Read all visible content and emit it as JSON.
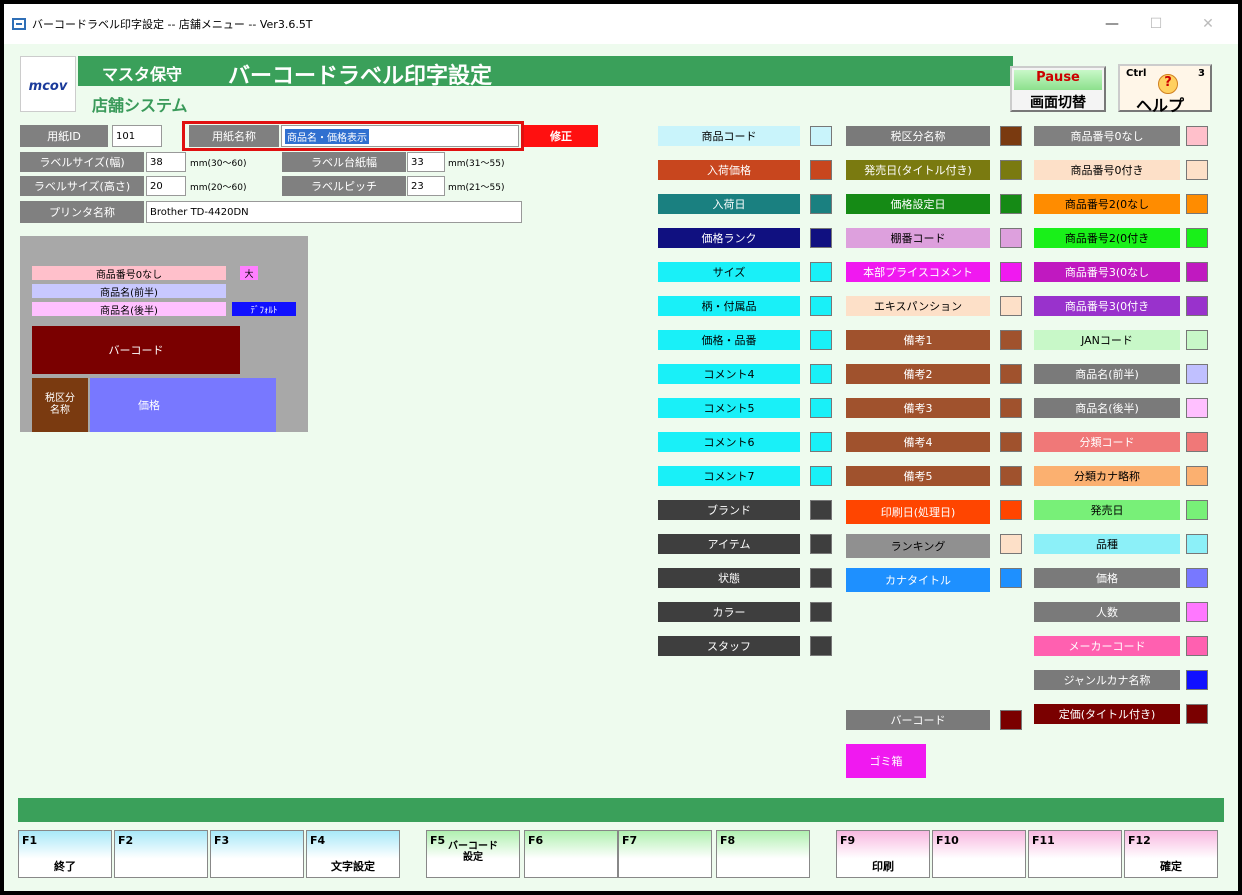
{
  "window": {
    "title": "バーコードラベル印字設定 -- 店舗メニュー -- Ver3.6.5T",
    "minimize": "—",
    "maximize": "☐",
    "close": "✕"
  },
  "header": {
    "logo": "mcov",
    "section": "マスタ保守",
    "title": "バーコードラベル印字設定",
    "system": "店舗システム",
    "pause_label": "Pause",
    "pause_sub": "画面切替",
    "help_ctrl": "Ctrl",
    "help_num": "3",
    "help_q": "?",
    "help_label": "ヘルプ"
  },
  "form": {
    "paper_id_label": "用紙ID",
    "paper_id": "101",
    "paper_name_label": "用紙名称",
    "paper_name": "商品名・価格表示",
    "edit_button": "修正",
    "width_label": "ラベルサイズ(幅)",
    "width": "38",
    "width_range": "mm(30～60)",
    "height_label": "ラベルサイズ(高さ)",
    "height": "20",
    "height_range": "mm(20～60)",
    "tabwidth_label": "ラベル台紙幅",
    "tabwidth": "33",
    "tabwidth_range": "mm(31～55)",
    "pitch_label": "ラベルピッチ",
    "pitch": "23",
    "pitch_range": "mm(21～55)",
    "printer_label": "プリンタ名称",
    "printer": "Brother TD-4420DN"
  },
  "preview": {
    "item1": "商品番号0なし",
    "item1_tag": "大",
    "item2": "商品名(前半)",
    "item3": "商品名(後半)",
    "item3_tag": "ﾃﾞﾌｫﾙﾄ",
    "barcode": "バーコード",
    "tax": "税区分\n名称",
    "price": "価格"
  },
  "palette": {
    "col1": [
      {
        "label": "商品コード",
        "bg": "#c9f4fb",
        "fg": "#000"
      },
      {
        "label": "入荷価格",
        "bg": "#c8461e",
        "fg": "#fff"
      },
      {
        "label": "入荷日",
        "bg": "#1a8080",
        "fg": "#fff"
      },
      {
        "label": "価格ランク",
        "bg": "#101080",
        "fg": "#fff"
      },
      {
        "label": "サイズ",
        "bg": "#19f0f8",
        "fg": "#000"
      },
      {
        "label": "柄・付属品",
        "bg": "#19f0f8",
        "fg": "#000"
      },
      {
        "label": "価格・品番",
        "bg": "#19f0f8",
        "fg": "#000"
      },
      {
        "label": "コメント4",
        "bg": "#19f0f8",
        "fg": "#000"
      },
      {
        "label": "コメント5",
        "bg": "#19f0f8",
        "fg": "#000"
      },
      {
        "label": "コメント6",
        "bg": "#19f0f8",
        "fg": "#000"
      },
      {
        "label": "コメント7",
        "bg": "#19f0f8",
        "fg": "#000"
      },
      {
        "label": "ブランド",
        "bg": "#3e3e3e",
        "fg": "#fff"
      },
      {
        "label": "アイテム",
        "bg": "#3e3e3e",
        "fg": "#fff"
      },
      {
        "label": "状態",
        "bg": "#3e3e3e",
        "fg": "#fff"
      },
      {
        "label": "カラー",
        "bg": "#3e3e3e",
        "fg": "#fff"
      },
      {
        "label": "スタッフ",
        "bg": "#3e3e3e",
        "fg": "#fff"
      }
    ],
    "col2": [
      {
        "label": "税区分名称",
        "bg": "#7a7a7a",
        "fg": "#fff",
        "sw": "#7a3a10"
      },
      {
        "label": "発売日(タイトル付き)",
        "bg": "#7a7a10",
        "fg": "#fff",
        "sw": "#7a7a10"
      },
      {
        "label": "価格設定日",
        "bg": "#158a15",
        "fg": "#fff",
        "sw": "#158a15"
      },
      {
        "label": "棚番コード",
        "bg": "#dda0dd",
        "fg": "#000",
        "sw": "#dda0dd"
      },
      {
        "label": "本部プライスコメント",
        "bg": "#f019f0",
        "fg": "#fff",
        "sw": "#f019f0"
      },
      {
        "label": "エキスパンション",
        "bg": "#fde0c8",
        "fg": "#000",
        "sw": "#fde0c8"
      },
      {
        "label": "備考1",
        "bg": "#a0522d",
        "fg": "#fff",
        "sw": "#a0522d"
      },
      {
        "label": "備考2",
        "bg": "#a0522d",
        "fg": "#fff",
        "sw": "#a0522d"
      },
      {
        "label": "備考3",
        "bg": "#a0522d",
        "fg": "#fff",
        "sw": "#a0522d"
      },
      {
        "label": "備考4",
        "bg": "#a0522d",
        "fg": "#fff",
        "sw": "#a0522d"
      },
      {
        "label": "備考5",
        "bg": "#a0522d",
        "fg": "#fff",
        "sw": "#a0522d"
      },
      {
        "label": "印刷日(処理日)",
        "bg": "#ff4500",
        "fg": "#fff",
        "sw": "#ff4500"
      },
      {
        "label": "ランキング",
        "bg": "#909090",
        "fg": "#000",
        "sw": "#fde0c8"
      },
      {
        "label": "カナタイトル",
        "bg": "#1e90ff",
        "fg": "#fff",
        "sw": "#1e90ff"
      },
      {
        "label": "バーコード",
        "bg": "#7a7a7a",
        "fg": "#fff",
        "sw": "#7a0000"
      }
    ],
    "col3": [
      {
        "label": "商品番号0なし",
        "bg": "#808080",
        "fg": "#fff",
        "sw": "#ffc0cb"
      },
      {
        "label": "商品番号0付き",
        "bg": "#fde0c8",
        "fg": "#000",
        "sw": "#fde0c8"
      },
      {
        "label": "商品番号2(0なし",
        "bg": "#ff8c00",
        "fg": "#000",
        "sw": "#ff8c00"
      },
      {
        "label": "商品番号2(0付き",
        "bg": "#19f019",
        "fg": "#000",
        "sw": "#19f019"
      },
      {
        "label": "商品番号3(0なし",
        "bg": "#c019c0",
        "fg": "#fff",
        "sw": "#c019c0"
      },
      {
        "label": "商品番号3(0付き",
        "bg": "#9932cc",
        "fg": "#fff",
        "sw": "#9932cc"
      },
      {
        "label": "JANコード",
        "bg": "#c8f8c8",
        "fg": "#000",
        "sw": "#c8f8c8"
      },
      {
        "label": "商品名(前半)",
        "bg": "#7a7a7a",
        "fg": "#fff",
        "sw": "#c0c0ff"
      },
      {
        "label": "商品名(後半)",
        "bg": "#7a7a7a",
        "fg": "#fff",
        "sw": "#ffc0ff"
      },
      {
        "label": "分類コード",
        "bg": "#f07878",
        "fg": "#fff",
        "sw": "#f07878"
      },
      {
        "label": "分類カナ略称",
        "bg": "#fbb070",
        "fg": "#000",
        "sw": "#fbb070"
      },
      {
        "label": "発売日",
        "bg": "#78f078",
        "fg": "#000",
        "sw": "#78f078"
      },
      {
        "label": "品種",
        "bg": "#8cf0f8",
        "fg": "#000",
        "sw": "#8cf0f8"
      },
      {
        "label": "価格",
        "bg": "#7a7a7a",
        "fg": "#fff",
        "sw": "#7878ff"
      },
      {
        "label": "人数",
        "bg": "#7a7a7a",
        "fg": "#fff",
        "sw": "#ff78ff"
      },
      {
        "label": "メーカーコード",
        "bg": "#ff60b0",
        "fg": "#fff",
        "sw": "#ff60b0"
      },
      {
        "label": "ジャンルカナ名称",
        "bg": "#7a7a7a",
        "fg": "#fff",
        "sw": "#1010ff"
      },
      {
        "label": "定価(タイトル付き)",
        "bg": "#7a0000",
        "fg": "#fff",
        "sw": "#7a0000"
      }
    ],
    "trash": "ゴミ箱"
  },
  "fkeys": [
    {
      "num": "F1",
      "label": "終了",
      "color": "#a8e8f8"
    },
    {
      "num": "F2",
      "label": "",
      "color": "#a8e8f8"
    },
    {
      "num": "F3",
      "label": "",
      "color": "#a8e8f8"
    },
    {
      "num": "F4",
      "label": "文字設定",
      "color": "#a8e8f8"
    },
    {
      "num": "F5",
      "label": "バーコード\n設定",
      "color": "#b0f0b0"
    },
    {
      "num": "F6",
      "label": "",
      "color": "#b0f0b0"
    },
    {
      "num": "F7",
      "label": "",
      "color": "#b0f0b0"
    },
    {
      "num": "F8",
      "label": "",
      "color": "#b0f0b0"
    },
    {
      "num": "F9",
      "label": "印刷",
      "color": "#f8b8e0"
    },
    {
      "num": "F10",
      "label": "",
      "color": "#f8b8e0"
    },
    {
      "num": "F11",
      "label": "",
      "color": "#f8b8e0"
    },
    {
      "num": "F12",
      "label": "確定",
      "color": "#f8b8e0"
    }
  ]
}
